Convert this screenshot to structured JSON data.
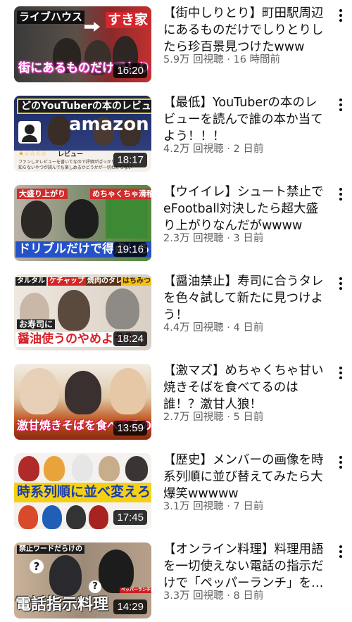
{
  "videos": [
    {
      "title": "【街中しりとり】町田駅周辺にあるものだけでしりとりしたら珍百景見つけたwww",
      "views": "5.9万 回視聴",
      "age": "16 時間前",
      "duration": "16:20",
      "thumb_text": [
        "ライブハウス",
        "すき家",
        "街にあるものだけでしりとり"
      ]
    },
    {
      "title": "【最低】YouTuberの本のレビューを読んで誰の本か当てよう！！！",
      "views": "4.2万 回視聴",
      "age": "2 日前",
      "duration": "18:17",
      "thumb_text": [
        "どのYouTuberの本のレビュー？",
        "amazon",
        "レビュー",
        "ファンしかレビューを書いてなので評価がぱっかり",
        "知らないやつが読んでも楽しめるかどうかが一切わからない"
      ]
    },
    {
      "title": "【ウイイレ】シュート禁止でeFootball対決したら超大盛り上がりなんだがwwww",
      "views": "2.3万 回視聴",
      "age": "3 日前",
      "duration": "19:16",
      "thumb_text": [
        "大盛り上がり",
        "めちゃくちゃ滑稽",
        "ドリブルだけで得点しろ！"
      ]
    },
    {
      "title": "【醤油禁止】寿司に合うタレを色々試して新たに見つけよう！",
      "views": "4.4万 回視聴",
      "age": "4 日前",
      "duration": "18:24",
      "thumb_text": [
        "タルタル",
        "ケチャップ",
        "焼肉のタレ",
        "はちみつ",
        "お寿司に",
        "醤油使うのやめよう？"
      ]
    },
    {
      "title": "【激マズ】めちゃくちゃ甘い焼きそばを食べてるのは誰！？激甘人狼！",
      "views": "2.7万 回視聴",
      "age": "5 日前",
      "duration": "13:59",
      "thumb_text": [
        "激甘焼きそばを食べてるのは誰"
      ]
    },
    {
      "title": "【歴史】メンバーの画像を時系列順に並び替えてみたら大爆笑wwwww",
      "views": "3.1万 回視聴",
      "age": "7 日前",
      "duration": "17:45",
      "thumb_text": [
        "時系列順に並べ変えろ"
      ]
    },
    {
      "title": "【オンライン料理】料理用語を一切使えない電話の指示だけで「ペッパーランチ」を…",
      "views": "3.3万 回視聴",
      "age": "8 日前",
      "duration": "14:29",
      "thumb_text": [
        "禁止ワードだらけの",
        "電話指示料理",
        "ペッパーランチ風"
      ]
    }
  ],
  "separator": " · "
}
